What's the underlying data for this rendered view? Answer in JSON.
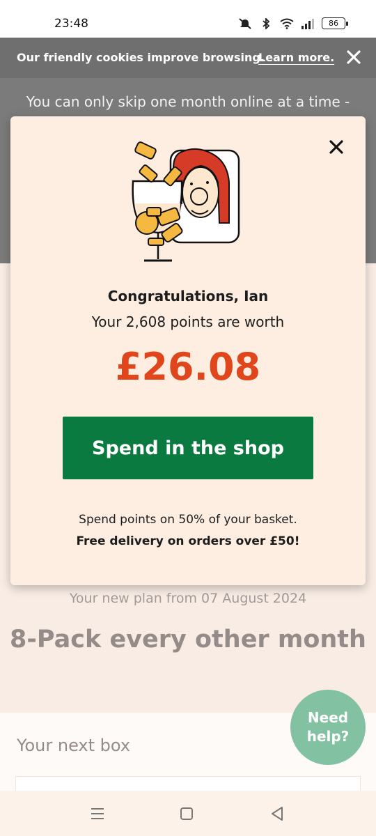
{
  "status_bar": {
    "time": "23:48",
    "battery": "86",
    "icons": [
      "mute-icon",
      "bluetooth-icon",
      "wifi-icon",
      "signal-icon",
      "battery-icon"
    ]
  },
  "cookie_banner": {
    "text": "Our friendly cookies improve browsing.",
    "link": "Learn more.",
    "close_icon": "close-icon"
  },
  "page": {
    "skip_notice": "You can only skip one month online at a time -",
    "plan_date": "Your new plan from 07 August 2024",
    "plan_name": "8-Pack every other month",
    "next_box_title": "Your next box",
    "help_line1": "Need",
    "help_line2": "help?"
  },
  "modal": {
    "congrats": "Congratulations, Ian",
    "points_text": "Your 2,608 points are worth",
    "amount": "£26.08",
    "button_label": "Spend in the shop",
    "note_line1": "Spend points on 50% of your basket.",
    "note_line2": "Free delivery on orders over £50!",
    "close_icon": "close-icon"
  },
  "nav_bar": {
    "icons": [
      "menu-icon",
      "home-icon",
      "back-icon"
    ]
  },
  "colors": {
    "accent_green": "#0a7a40",
    "amount_red": "#e0461c",
    "help_bubble": "#82c1a2",
    "modal_bg": "#fdeee1"
  }
}
